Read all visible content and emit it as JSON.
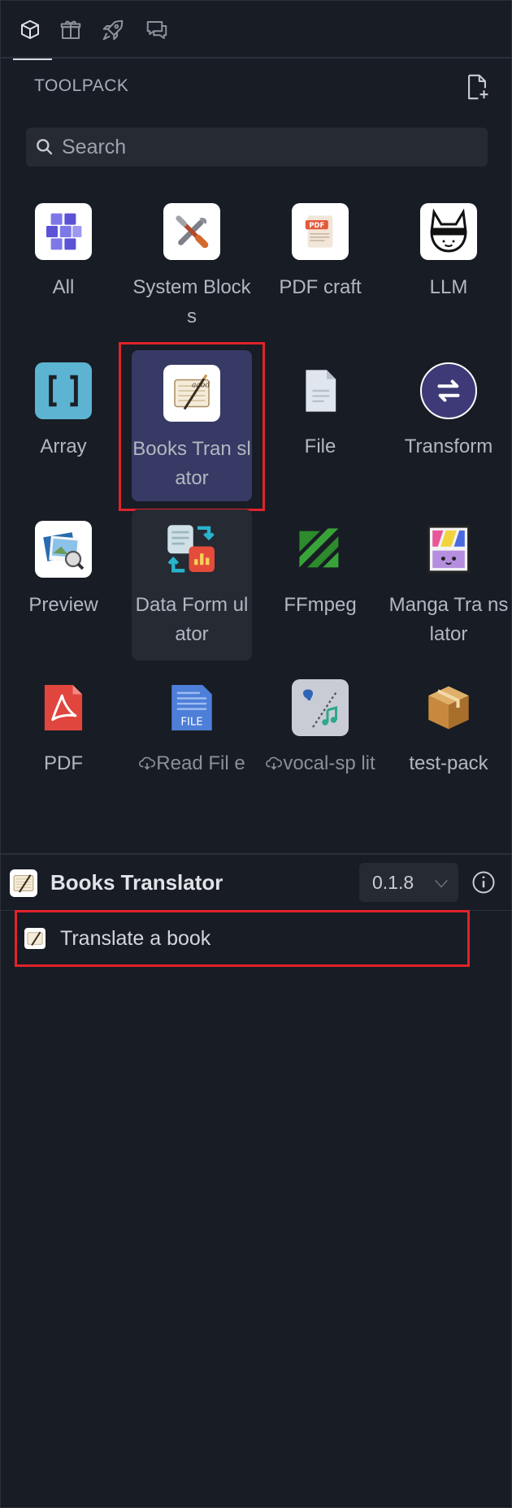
{
  "tabs": [
    {
      "icon": "cube-icon",
      "active": true
    },
    {
      "icon": "gift-icon",
      "active": false
    },
    {
      "icon": "rocket-icon",
      "active": false
    },
    {
      "icon": "chat-icon",
      "active": false
    }
  ],
  "header": {
    "title": "TOOLPACK"
  },
  "search": {
    "placeholder": "Search",
    "value": ""
  },
  "packs": [
    {
      "name": "All",
      "icon": "all-blocks-icon"
    },
    {
      "name": "System Blocks",
      "icon": "tools-icon"
    },
    {
      "name": "PDF craft",
      "icon": "pdf-craft-icon"
    },
    {
      "name": "LLM",
      "icon": "llm-fox-icon"
    },
    {
      "name": "Array",
      "icon": "brackets-icon"
    },
    {
      "name": "Books Tran slator",
      "icon": "notebook-pen-icon",
      "selected": true
    },
    {
      "name": "File",
      "icon": "file-icon"
    },
    {
      "name": "Transform",
      "icon": "swap-icon"
    },
    {
      "name": "Preview",
      "icon": "preview-icon"
    },
    {
      "name": "Data Form ulator",
      "icon": "data-formulator-icon"
    },
    {
      "name": "FFmpeg",
      "icon": "ffmpeg-icon"
    },
    {
      "name": "Manga Tra nslator",
      "icon": "manga-icon"
    },
    {
      "name": "PDF",
      "icon": "acrobat-icon"
    },
    {
      "name": "Read Fil e",
      "icon": "file-doc-icon",
      "cloud": true
    },
    {
      "name": "vocal-sp lit",
      "icon": "vocal-split-icon",
      "cloud": true
    },
    {
      "name": "test-pack",
      "icon": "package-box-icon"
    }
  ],
  "detail": {
    "title": "Books Translator",
    "version": "0.1.8",
    "blocks": [
      {
        "label": "Translate a book"
      }
    ]
  },
  "colors": {
    "background": "#181c24",
    "selected": "#363a64",
    "highlight": "#e0232a"
  }
}
